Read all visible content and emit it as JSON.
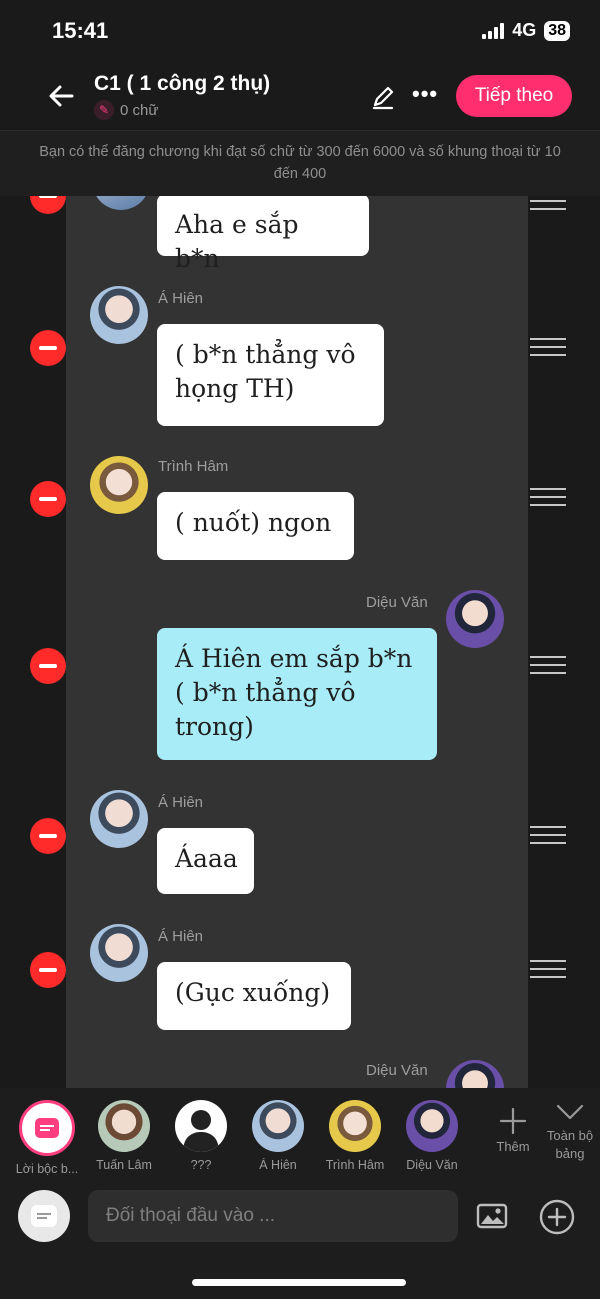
{
  "status_bar": {
    "time": "15:41",
    "network": "4G",
    "battery": "38"
  },
  "header": {
    "title": "C1 ( 1 công 2 thụ)",
    "word_count": "0 chữ",
    "next_button": "Tiếp theo"
  },
  "notice": "Bạn có thể đăng chương khi đạt số chữ từ 300 đến 6000 và số khung thoại từ 10 đến 400",
  "messages": [
    {
      "speaker": "",
      "text": "Aha e sắp b*n",
      "side": "left"
    },
    {
      "speaker": "Á Hiên",
      "text": "( b*n thẳng vô họng TH)",
      "side": "left"
    },
    {
      "speaker": "Trình Hâm",
      "text": "( nuốt) ngon",
      "side": "left"
    },
    {
      "speaker": "Diệu Văn",
      "text": "Á Hiên em sắp b*n ( b*n thẳng vô trong)",
      "side": "right"
    },
    {
      "speaker": "Á Hiên",
      "text": "Áaaa",
      "side": "left"
    },
    {
      "speaker": "Á Hiên",
      "text": "(Gục xuống)",
      "side": "left"
    },
    {
      "speaker": "Diệu Văn",
      "text": "",
      "side": "right"
    }
  ],
  "characters": [
    {
      "name": "Lời bộc b..."
    },
    {
      "name": "Tuấn Lâm"
    },
    {
      "name": "???"
    },
    {
      "name": "Á Hiên"
    },
    {
      "name": "Trình Hâm"
    },
    {
      "name": "Diệu Văn"
    }
  ],
  "more_label": "Thêm",
  "collapse_label": "Toàn bộ bảng",
  "input": {
    "placeholder": "Đối thoại đầu vào ..."
  },
  "colors": {
    "accent": "#ff2f6f",
    "self_bubble": "#a8ecf7",
    "remove": "#ff2b2b",
    "lane": "#333333"
  }
}
